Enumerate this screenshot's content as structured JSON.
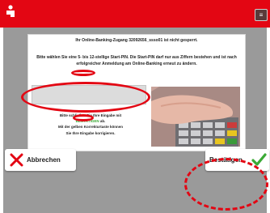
{
  "header": {
    "brand_color": "#e30613",
    "logo_icon": "sparkasse-logo-icon",
    "corner_button_glyph": "≡"
  },
  "dialog": {
    "title": "Ihr Online-Banking-Zugang 32092656_ssso01 ist nicht gesperrt.",
    "body": "Bitte wählen Sie eine 5- bis 12-stellige Start-PIN. Die Start-PIN darf nur aus Ziffern bestehen und ist nach erfolgreicher Anmeldung am Online-Banking erneut zu ändern.",
    "pin_field_value": "",
    "finish_hint": {
      "before": "Bitte schließen Sie Ihre Eingabe mit",
      "highlight": "BESTÄTIGEN",
      "after": "ab."
    },
    "correction_hint_line1": "Mit der gelben Korrekturtaste können",
    "correction_hint_line2": "Sie Ihre Eingabe korrigieren.",
    "photo_icon": "hand-on-pinpad-photo"
  },
  "footer": {
    "cancel_label": "Abbrechen",
    "cancel_icon": "x-icon",
    "confirm_label": "Bestätigen",
    "confirm_icon": "checkmark-icon"
  },
  "colors": {
    "background_gray": "#9a9a9a",
    "annotation_red": "#e30613",
    "highlight_green": "#3aaa35"
  }
}
